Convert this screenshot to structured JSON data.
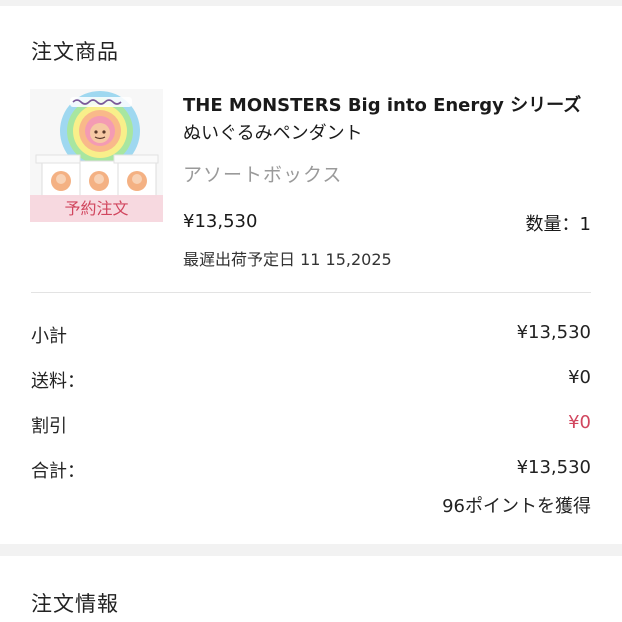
{
  "order_items": {
    "title": "注文商品",
    "product": {
      "name_line1": "THE MONSTERS Big into Energy シリーズ",
      "name_line2": "ぬいぐるみペンダント",
      "variant": "アソートボックス",
      "badge": "予約注文",
      "price": "¥13,530",
      "quantity": "数量：1",
      "ship_date": "最遅出荷予定日 11 15,2025"
    }
  },
  "summary": {
    "subtotal_label": "小計",
    "subtotal_value": "¥13,530",
    "shipping_label": "送料：",
    "shipping_value": "¥0",
    "discount_label": "割引",
    "discount_value": "¥0",
    "total_label": "合計：",
    "total_value": "¥13,530",
    "points": "96ポイントを獲得"
  },
  "order_info": {
    "title": "注文情報"
  },
  "colors": {
    "accent": "#d1465e",
    "badge_bg": "#f6d6dd",
    "muted_text": "#9a9a9a",
    "divider": "#e3e3e3",
    "page_bg": "#f2f2f2"
  }
}
